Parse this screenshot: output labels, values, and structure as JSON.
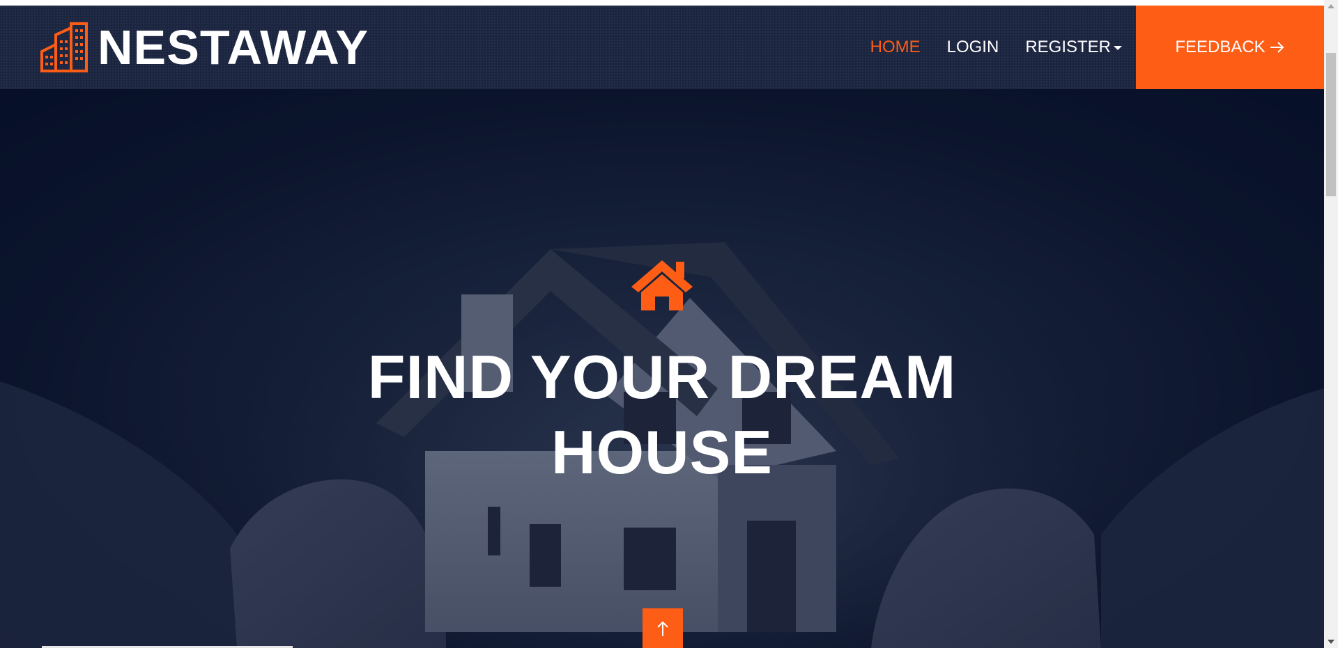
{
  "brand": {
    "name": "NESTAWAY",
    "icon": "buildings-icon",
    "accent_color": "#fe5d16"
  },
  "nav": {
    "items": [
      {
        "label": "HOME",
        "active": true
      },
      {
        "label": "LOGIN",
        "active": false
      },
      {
        "label": "REGISTER",
        "active": false,
        "dropdown": true
      }
    ],
    "feedback_label": "FEEDBACK",
    "feedback_icon": "arrow-right-icon",
    "background_color": "#1b2540"
  },
  "hero": {
    "icon": "home-icon",
    "title_line1": "FIND YOUR DREAM",
    "title_line2": "HOUSE",
    "back_to_top_icon": "arrow-up-icon"
  },
  "scrollbar": {
    "thumb_color": "#c1c1c1"
  }
}
